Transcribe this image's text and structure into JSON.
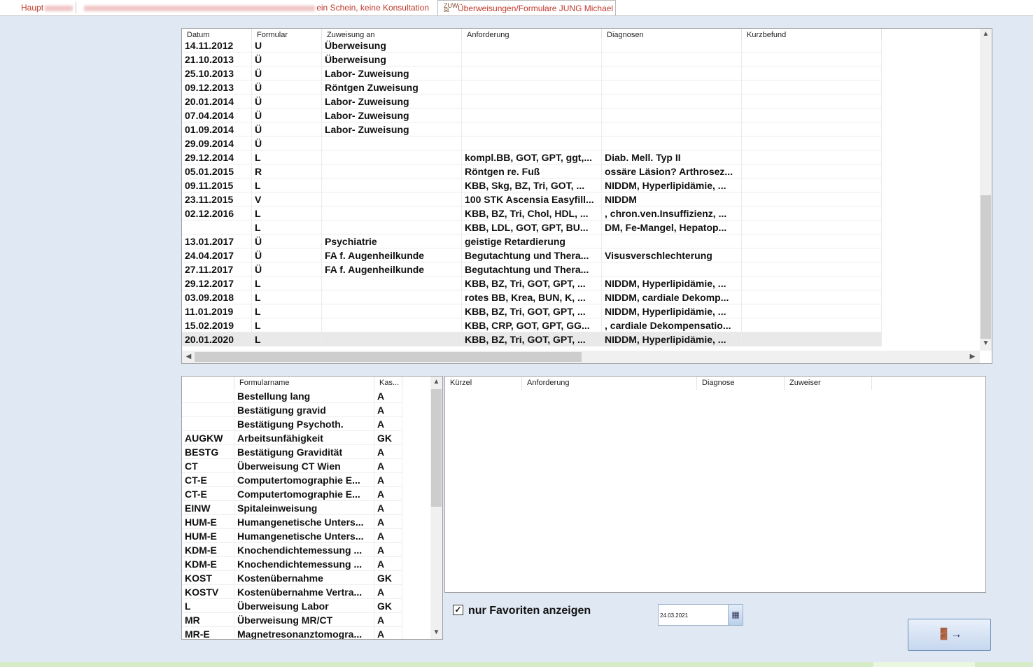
{
  "tabs": [
    {
      "label": "Haupt"
    },
    {
      "label": "ein Schein, keine Konsultation"
    },
    {
      "label": "Überweisungen/Formulare JUNG Michael"
    }
  ],
  "top_grid": {
    "columns": [
      "Datum",
      "Formular",
      "Zuweisung an",
      "Anforderung",
      "Diagnosen",
      "Kurzbefund"
    ],
    "rows": [
      [
        "14.11.2012",
        "U",
        "Überweisung",
        "",
        "",
        ""
      ],
      [
        "21.10.2013",
        "Ü",
        "Überweisung",
        "",
        "",
        ""
      ],
      [
        "25.10.2013",
        "Ü",
        "Labor- Zuweisung",
        "",
        "",
        ""
      ],
      [
        "09.12.2013",
        "Ü",
        "Röntgen Zuweisung",
        "",
        "",
        ""
      ],
      [
        "20.01.2014",
        "Ü",
        "Labor- Zuweisung",
        "",
        "",
        ""
      ],
      [
        "07.04.2014",
        "Ü",
        "Labor- Zuweisung",
        "",
        "",
        ""
      ],
      [
        "01.09.2014",
        "Ü",
        "Labor- Zuweisung",
        "",
        "",
        ""
      ],
      [
        "29.09.2014",
        "Ü",
        "",
        "",
        "",
        ""
      ],
      [
        "29.12.2014",
        "L",
        "",
        "kompl.BB, GOT, GPT, ggt,...",
        "Diab. Mell. Typ II",
        ""
      ],
      [
        "05.01.2015",
        "R",
        "",
        "Röntgen re. Fuß",
        "ossäre Läsion? Arthrosez...",
        ""
      ],
      [
        "09.11.2015",
        "L",
        "",
        "KBB, Skg, BZ, Tri, GOT, ...",
        "NIDDM,  Hyperlipidämie,  ...",
        ""
      ],
      [
        "23.11.2015",
        "V",
        "",
        "100 STK Ascensia Easyfill...",
        "NIDDM",
        ""
      ],
      [
        "02.12.2016",
        "L",
        "",
        "KBB, BZ, Tri, Chol, HDL, ...",
        ", chron.ven.Insuffizienz, ...",
        ""
      ],
      [
        "",
        "L",
        "",
        "KBB, LDL, GOT, GPT, BU...",
        "DM, Fe-Mangel, Hepatop...",
        ""
      ],
      [
        "13.01.2017",
        "Ü",
        "Psychiatrie",
        "geistige Retardierung",
        "",
        ""
      ],
      [
        "24.04.2017",
        "Ü",
        "FA f. Augenheilkunde",
        "Begutachtung und Thera...",
        "Visusverschlechterung",
        ""
      ],
      [
        "27.11.2017",
        "Ü",
        "FA f. Augenheilkunde",
        "Begutachtung und Thera...",
        "",
        ""
      ],
      [
        "29.12.2017",
        "L",
        "",
        "KBB, BZ, Tri, GOT, GPT, ...",
        "NIDDM,  Hyperlipidämie,  ...",
        ""
      ],
      [
        "03.09.2018",
        "L",
        "",
        "rotes BB, Krea, BUN, K, ...",
        "NIDDM, cardiale Dekomp...",
        ""
      ],
      [
        "11.01.2019",
        "L",
        "",
        "KBB, BZ, Tri, GOT, GPT, ...",
        "NIDDM,  Hyperlipidämie,  ...",
        ""
      ],
      [
        "15.02.2019",
        "L",
        "",
        "KBB, CRP, GOT, GPT, GG...",
        ", cardiale Dekompensatio...",
        ""
      ],
      [
        "20.01.2020",
        "L",
        "",
        "KBB, BZ, Tri, GOT, GPT, ...",
        "NIDDM,  Hyperlipidämie,  ...",
        ""
      ]
    ]
  },
  "forms_grid": {
    "columns": [
      "",
      "Formularname",
      "Kas..."
    ],
    "rows": [
      [
        "",
        "Bestellung lang",
        "A"
      ],
      [
        "",
        "Bestätigung gravid",
        "A"
      ],
      [
        "",
        "Bestätigung Psychoth.",
        "A"
      ],
      [
        "AUGKW",
        "Arbeitsunfähigkeit",
        "GK"
      ],
      [
        "BESTG",
        "Bestätigung Gravidität",
        "A"
      ],
      [
        "CT",
        "Überweisung CT Wien",
        "A"
      ],
      [
        "CT-E",
        "Computertomographie E...",
        "A"
      ],
      [
        "CT-E",
        "Computertomographie E...",
        "A"
      ],
      [
        "EINW",
        "Spitaleinweisung",
        "A"
      ],
      [
        "HUM-E",
        "Humangenetische Unters...",
        "A"
      ],
      [
        "HUM-E",
        "Humangenetische Unters...",
        "A"
      ],
      [
        "KDM-E",
        "Knochendichtemessung ...",
        "A"
      ],
      [
        "KDM-E",
        "Knochendichtemessung ...",
        "A"
      ],
      [
        "KOST",
        "Kostenübernahme",
        "GK"
      ],
      [
        "KOSTV",
        "Kostenübernahme Vertra...",
        "A"
      ],
      [
        "L",
        "Überweisung Labor",
        "GK"
      ],
      [
        "MR",
        "Überweisung MR/CT",
        "A"
      ],
      [
        "MR-E",
        "Magnetresonanztomogra...",
        "A"
      ]
    ]
  },
  "detail_grid": {
    "columns": [
      "Kürzel",
      "Anforderung",
      "Diagnose",
      "Zuweiser"
    ]
  },
  "favorites": {
    "label": "nur Favoriten anzeigen",
    "checked": true,
    "check_glyph": "✓"
  },
  "date_field": {
    "value": "24.03.2021",
    "icon": "calendar-icon"
  },
  "exit_button": {
    "icon": "exit-door-icon"
  }
}
